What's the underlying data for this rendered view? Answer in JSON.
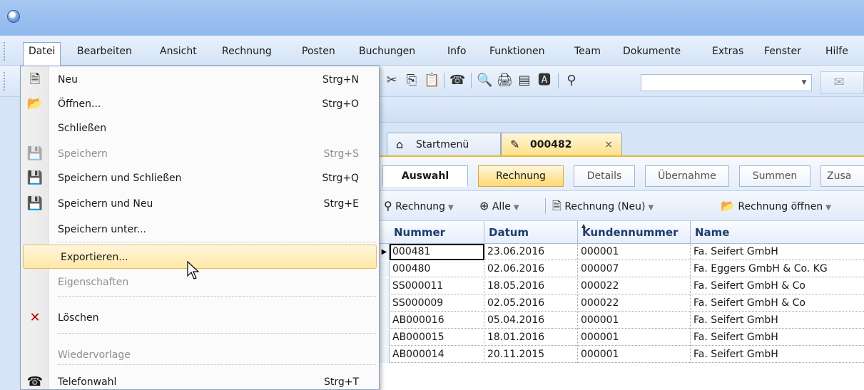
{
  "menubar": {
    "items": [
      "Datei",
      "Bearbeiten",
      "Ansicht",
      "Rechnung",
      "Posten",
      "Buchungen",
      "Info",
      "Funktionen",
      "Team",
      "Dokumente",
      "Extras",
      "Fenster",
      "Hilfe"
    ]
  },
  "file_menu": {
    "items": [
      {
        "label": "Neu",
        "shortcut": "Strg+N",
        "icon": "new-doc-icon",
        "enabled": true
      },
      {
        "label": "Öffnen...",
        "shortcut": "Strg+O",
        "icon": "open-folder-icon",
        "enabled": true
      },
      {
        "label": "Schließen",
        "shortcut": "",
        "icon": "",
        "enabled": true
      },
      {
        "label": "Speichern",
        "shortcut": "Strg+S",
        "icon": "save-icon",
        "enabled": false
      },
      {
        "label": "Speichern und Schließen",
        "shortcut": "Strg+Q",
        "icon": "save-close-icon",
        "enabled": true
      },
      {
        "label": "Speichern und Neu",
        "shortcut": "Strg+E",
        "icon": "save-new-icon",
        "enabled": true
      },
      {
        "label": "Speichern unter...",
        "shortcut": "",
        "icon": "",
        "enabled": true
      },
      {
        "label": "Exportieren...",
        "shortcut": "",
        "icon": "",
        "enabled": true,
        "hover": true
      },
      {
        "label": "Eigenschaften",
        "shortcut": "",
        "icon": "",
        "enabled": false
      },
      {
        "label": "Löschen",
        "shortcut": "",
        "icon": "delete-icon",
        "enabled": true
      },
      {
        "label": "Wiedervorlage",
        "shortcut": "",
        "icon": "",
        "enabled": false
      },
      {
        "label": "Telefonwahl",
        "shortcut": "Strg+T",
        "icon": "phone-icon",
        "enabled": true
      }
    ]
  },
  "doc_tabs": {
    "home_label": "Startmenü",
    "active_label": "000482",
    "close_glyph": "×"
  },
  "sub_tabs": [
    "Auswahl",
    "Rechnung",
    "Details",
    "Übernahme",
    "Summen",
    "Zusa"
  ],
  "grid_toolbar": {
    "rechnung": "Rechnung",
    "alle": "Alle",
    "neu": "Rechnung (Neu)",
    "oeffnen": "Rechnung öffnen"
  },
  "grid": {
    "columns": [
      "Nummer",
      "Datum",
      "Kundennummer",
      "Name"
    ],
    "rows": [
      [
        "000481",
        "23.06.2016",
        "000001",
        "Fa. Seifert GmbH"
      ],
      [
        "000480",
        "02.06.2016",
        "000007",
        "Fa. Eggers GmbH & Co. KG"
      ],
      [
        "SS000011",
        "18.05.2016",
        "000022",
        "Fa. Seifert GmbH & Co"
      ],
      [
        "SS000009",
        "02.05.2016",
        "000022",
        "Fa. Seifert GmbH & Co"
      ],
      [
        "AB000016",
        "05.04.2016",
        "000001",
        "Fa. Seifert GmbH"
      ],
      [
        "AB000015",
        "18.01.2016",
        "000001",
        "Fa. Seifert GmbH"
      ],
      [
        "AB000014",
        "20.11.2015",
        "000001",
        "Fa. Seifert GmbH"
      ]
    ]
  },
  "colors": {
    "accent": "#e7b935",
    "hover_bg": "#ffe7a6",
    "header_text": "#1f3c6e"
  }
}
